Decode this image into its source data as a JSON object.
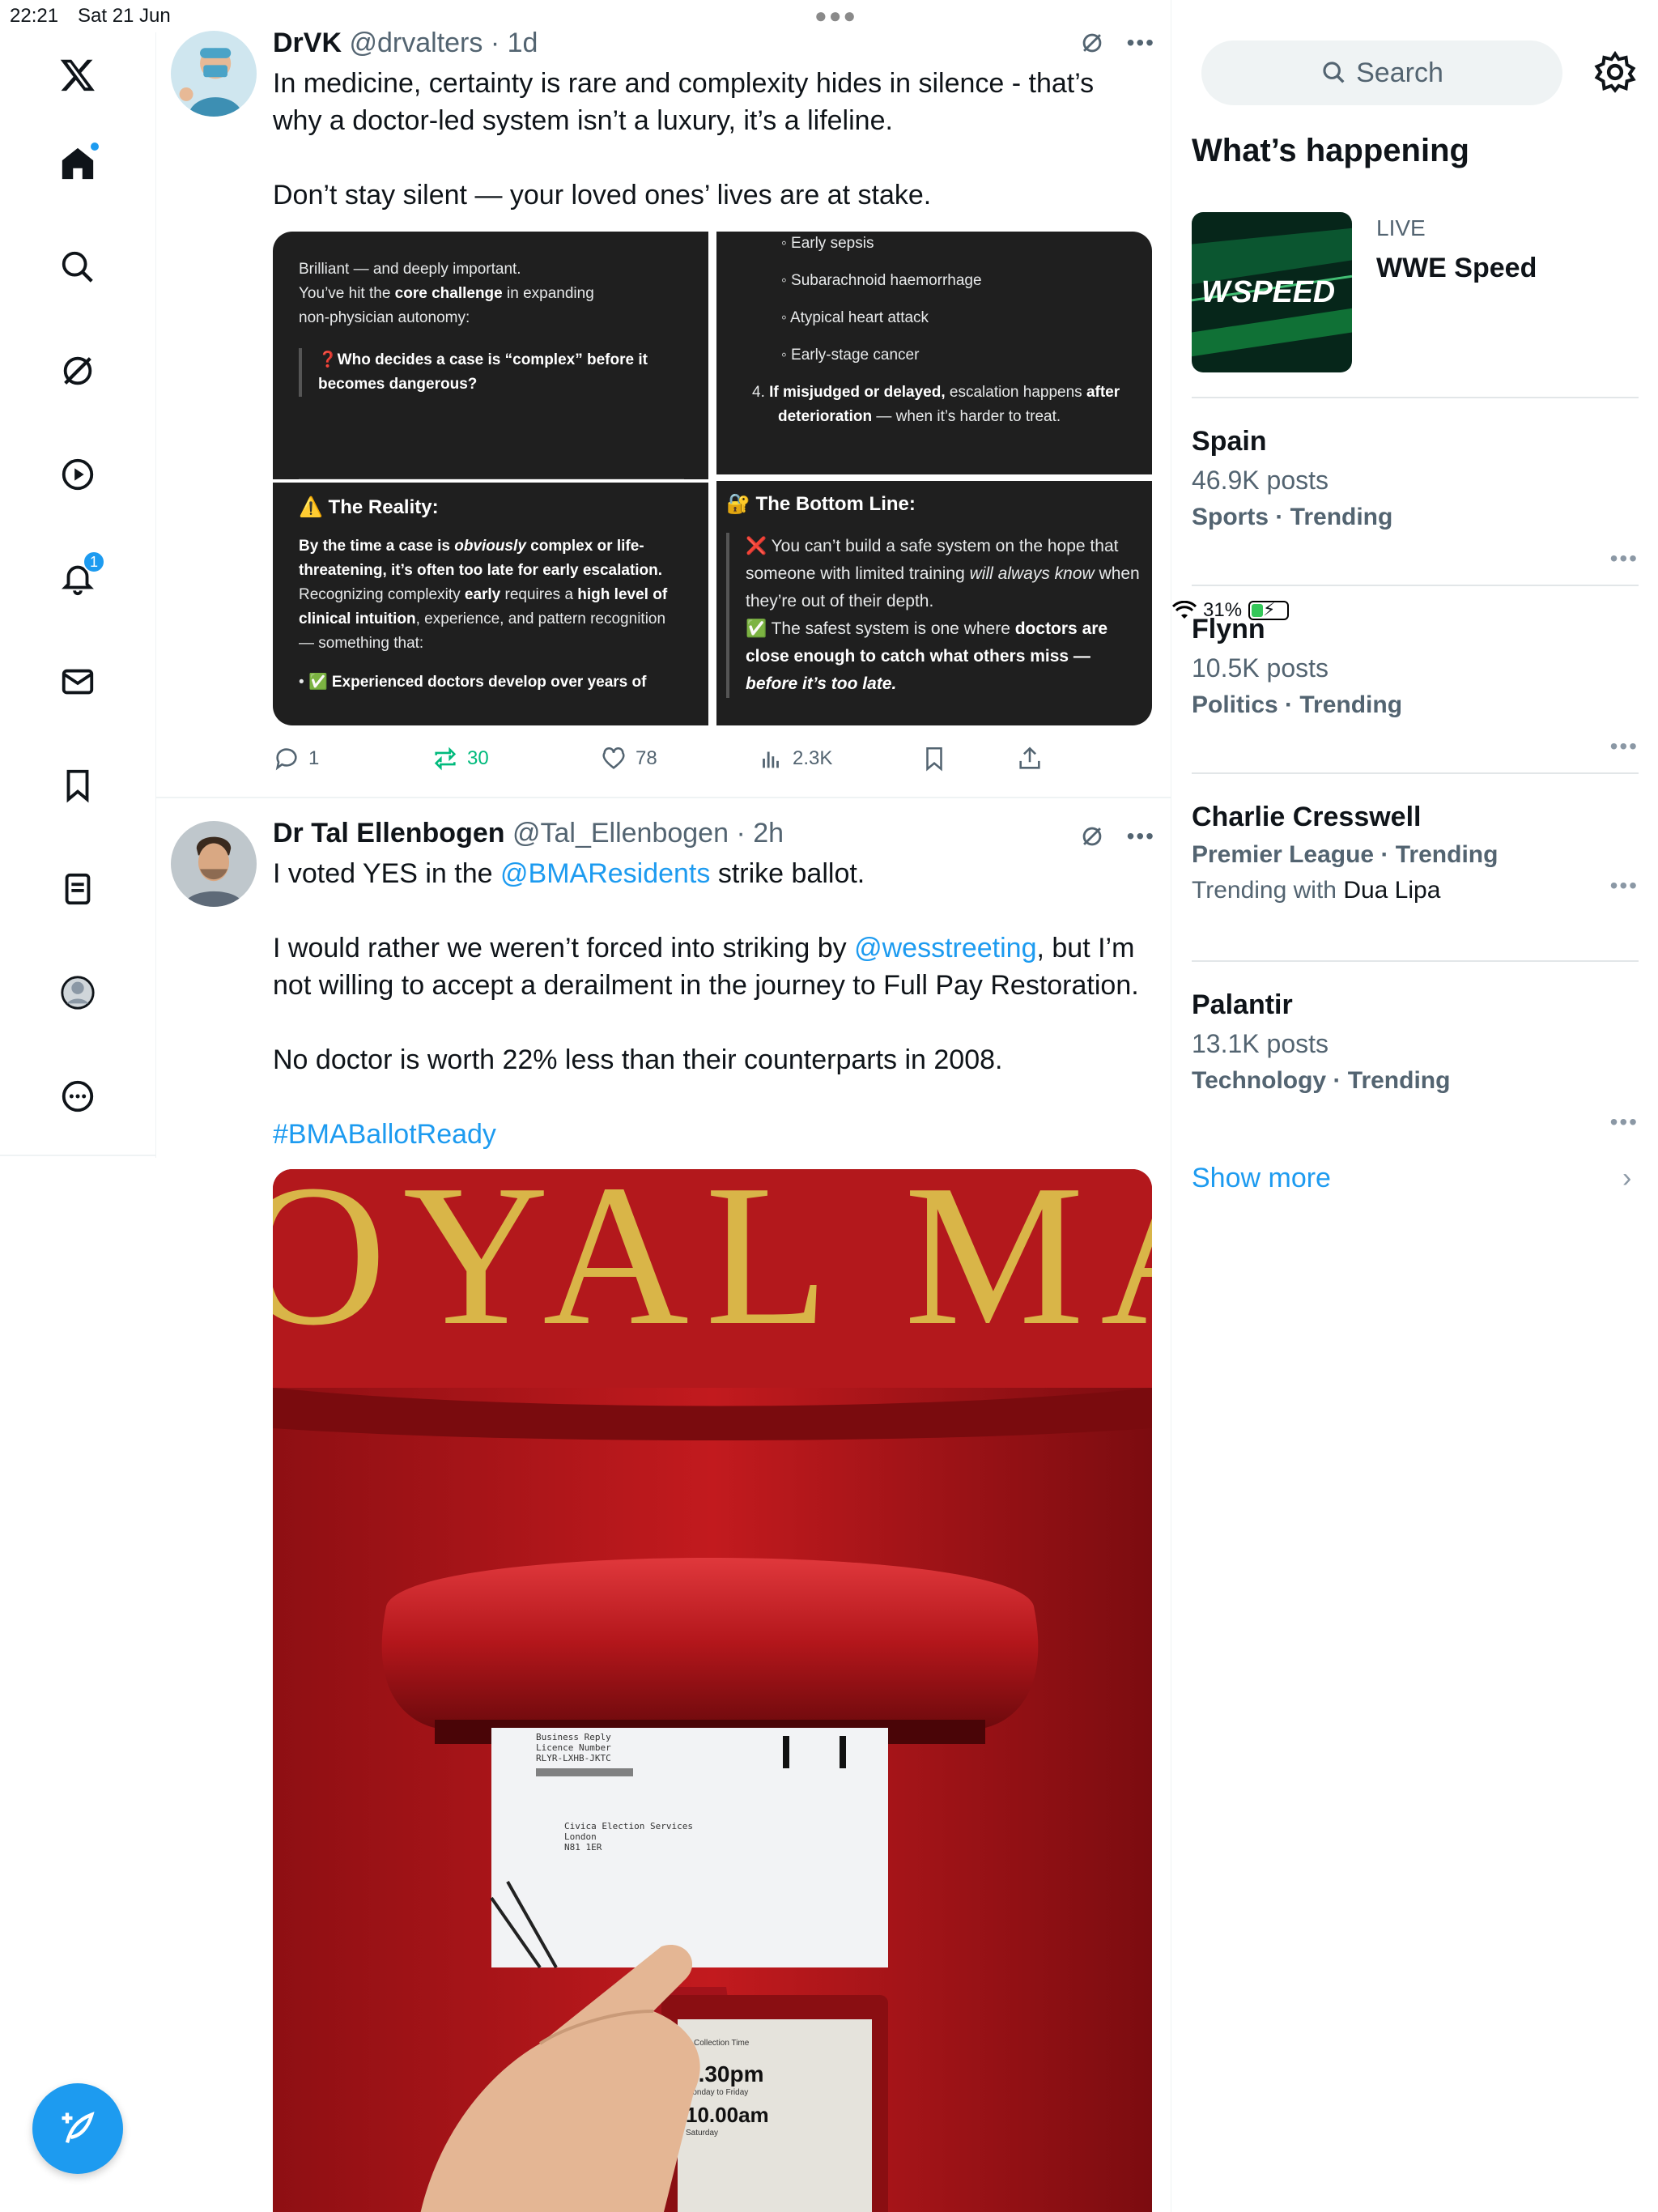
{
  "status": {
    "time": "22:21",
    "date": "Sat 21 Jun",
    "battery": "31%",
    "battery_level": 0.31
  },
  "nav": {
    "notifications_badge": "1"
  },
  "tweets": [
    {
      "name": "DrVK",
      "handle": "@drvalters",
      "time": "· 1d",
      "text": "In medicine, certainty is rare and complexity hides in silence - that’s why a doctor-led system isn’t a luxury, it’s a lifeline.\n\nDon’t stay silent — your loved ones’ lives are at stake.",
      "media": {
        "c1_intro": "Brilliant — and deeply important.",
        "c1_line2a": "You’ve hit the ",
        "c1_line2b": "core challenge",
        "c1_line2c": " in expanding",
        "c1_line3": "non-physician autonomy:",
        "c1_quote": "❓Who decides a case is “complex” before it becomes dangerous?",
        "c3_heading": "⚠️ The Reality:",
        "c3_p1a": "By the time a case is ",
        "c3_p1b": "obviously",
        "c3_p1c": " complex or life-threatening, it’s often too late for early escalation.",
        "c3_p2a": "Recognizing complexity ",
        "c3_p2b": "early",
        "c3_p2c": " requires a ",
        "c3_p2d": "high level of clinical intuition",
        "c3_p2e": ", experience, and pattern recognition — something that:",
        "c3_bullet": "✅ Experienced doctors develop over years of",
        "c2_items": [
          "Early sepsis",
          "Subarachnoid haemorrhage",
          "Atypical heart attack",
          "Early-stage cancer"
        ],
        "c2_num": "4.",
        "c2_p4a": "If misjudged or delayed,",
        "c2_p4b": " escalation happens ",
        "c2_p4c": "after deterioration",
        "c2_p4d": " — when it’s harder to treat.",
        "c4_heading": "🔐 The Bottom Line:",
        "c4_p1a": "❌ You can’t build a safe system on the hope that someone with limited training ",
        "c4_p1b": "will always know",
        "c4_p1c": " when they’re out of their depth.",
        "c4_p2a": "✅ The safest system is one where ",
        "c4_p2b": "doctors are close enough to catch what others miss — ",
        "c4_p2c": "before it’s too late."
      },
      "replies": "1",
      "reposts": "30",
      "likes": "78",
      "views": "2.3K"
    },
    {
      "name": "Dr Tal Ellenbogen",
      "handle": "@Tal_Ellenbogen",
      "time": "· 2h",
      "text_1": "I voted YES in the ",
      "mention_1": "@BMAResidents",
      "text_2": " strike ballot.",
      "text_3": "I would rather we weren’t forced into striking by ",
      "mention_2": "@wesstreeting",
      "text_4": ", but I’m not willing to accept a derailment in the journey to Full Pay Restoration.",
      "text_5": "No doctor is worth 22% less than their counterparts in 2008.",
      "hashtag": "#BMABallotReady",
      "photo": {
        "lettering": "OYAL MA",
        "envelope_line1": "Business Reply",
        "envelope_line2": "Licence Number",
        "envelope_line3": "RLYR-LXHB-JKTC",
        "address_1": "Civica Election Services",
        "address_2": "London",
        "address_3": "N81 1ER",
        "sign_1": "Collection Time",
        "sign_2": "5.30pm",
        "sign_3": "Monday to Friday",
        "sign_4": "10.00am",
        "sign_5": "Saturday"
      }
    }
  ],
  "sidebar": {
    "search_placeholder": "Search",
    "heading": "What’s happening",
    "live_label": "LIVE",
    "live_title": "WWE Speed",
    "live_logo": "SPEED",
    "trends": [
      {
        "name": "Spain",
        "posts": "46.9K posts",
        "category": "Sports · Trending"
      },
      {
        "name": "Flynn",
        "posts": "10.5K posts",
        "category": "Politics · Trending"
      },
      {
        "name": "Charlie Cresswell",
        "category": "Premier League · Trending",
        "with_prefix": "Trending with ",
        "with_name": "Dua Lipa"
      },
      {
        "name": "Palantir",
        "posts": "13.1K posts",
        "category": "Technology · Trending"
      }
    ],
    "show_more": "Show more"
  },
  "colors": {
    "accent": "#1d9bf0",
    "repost_green": "#00ba7c",
    "text_secondary": "#536471"
  }
}
